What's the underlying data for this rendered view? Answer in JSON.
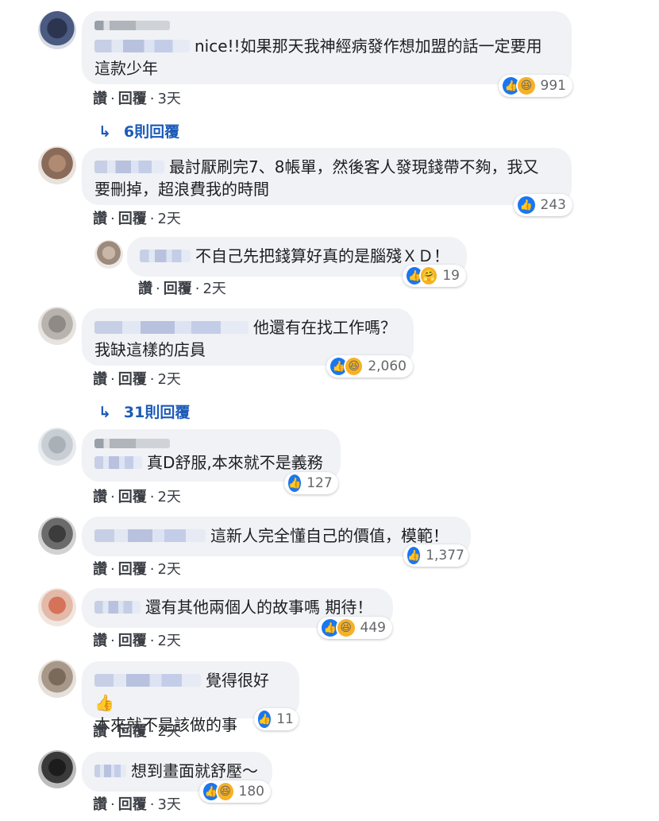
{
  "actions": {
    "like": "讚",
    "reply": "回覆",
    "separator": "·"
  },
  "comments": [
    {
      "text_line1": "nice!!如果那天我神經病發作想加盟的話一定要用",
      "text_line2": "這款少年",
      "reactions": "991",
      "time": "3天",
      "replies": "6則回覆"
    },
    {
      "text_line1": "最討厭刷完7、8帳單，然後客人發現錢帶不夠，我又",
      "text_line2": "要刪掉，超浪費我的時間",
      "reactions": "243",
      "time": "2天"
    },
    {
      "text_line1": "不自己先把錢算好真的是腦殘ＸＤ！",
      "reactions": "19",
      "time": "2天"
    },
    {
      "text_line1": "他還有在找工作嗎？",
      "text_line2": "我缺這樣的店員",
      "reactions": "2,060",
      "time": "2天",
      "replies": "31則回覆"
    },
    {
      "text_line1": "真D舒服,本來就不是義務",
      "reactions": "127",
      "time": "2天"
    },
    {
      "text_line1": "這新人完全懂自己的價值，模範！",
      "reactions": "1,377",
      "time": "2天"
    },
    {
      "text_line1": "還有其他兩個人的故事嗎 期待！",
      "reactions": "449",
      "time": "2天"
    },
    {
      "text_line1": "覺得很好👍",
      "text_line2": "本來就不是該做的事",
      "reactions": "11",
      "time": "2天"
    },
    {
      "text_line1": "想到畫面就舒壓～",
      "reactions": "180",
      "time": "3天"
    }
  ],
  "icons": {
    "like": "like-icon",
    "haha": "haha-icon",
    "care": "care-icon",
    "reply_arrow": "reply-arrow-icon"
  },
  "colors": {
    "like_blue": "#1877f2",
    "link_blue": "#1c5bb8",
    "bubble": "#f0f2f5"
  }
}
